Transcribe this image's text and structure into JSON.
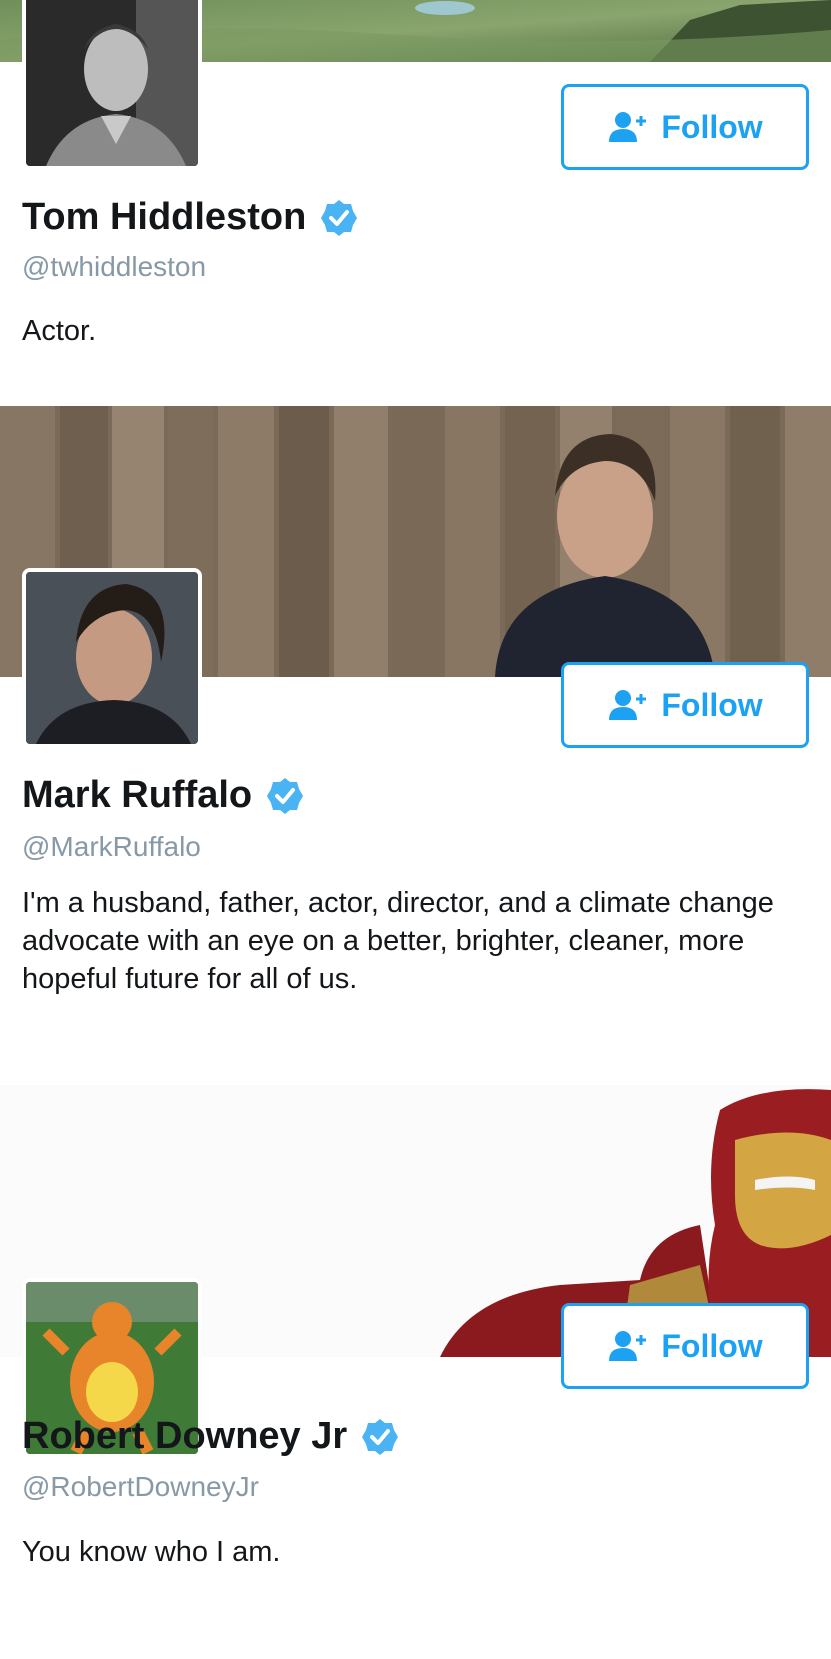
{
  "profiles": [
    {
      "name": "Tom Hiddleston",
      "handle": "@twhiddleston",
      "bio": "Actor.",
      "follow_label": "Follow",
      "verified": true
    },
    {
      "name": "Mark Ruffalo",
      "handle": "@MarkRuffalo",
      "bio": "I'm a husband, father, actor, director, and a climate change advocate with an eye on a better, brighter, cleaner, more hopeful future for all of us.",
      "follow_label": "Follow",
      "verified": true
    },
    {
      "name": "Robert Downey Jr",
      "handle": "@RobertDowneyJr",
      "bio": "You know who I am.",
      "follow_label": "Follow",
      "verified": true
    }
  ],
  "colors": {
    "accent": "#1da1f2",
    "verified": "#4ab3f4",
    "handle": "#8899a6",
    "text": "#14171a"
  },
  "icons": {
    "follow": "add-user-icon",
    "verified": "verified-badge-icon"
  }
}
